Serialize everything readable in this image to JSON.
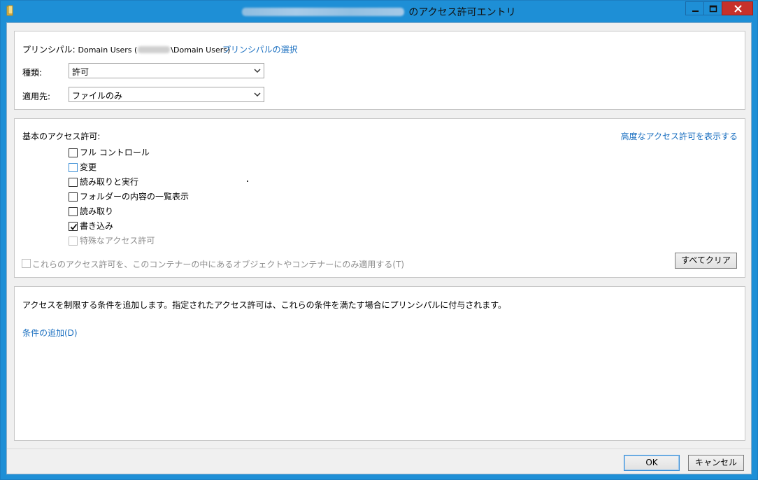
{
  "window": {
    "title_suffix": "のアクセス許可エントリ",
    "minimize_label": "",
    "maximize_label": "",
    "close_label": ""
  },
  "principal": {
    "label": "プリンシパル:",
    "value_prefix": "Domain Users (",
    "value_suffix": "\\Domain Users)",
    "select_link": "プリンシパルの選択"
  },
  "type_field": {
    "label": "種類:",
    "value": "許可"
  },
  "applies_field": {
    "label": "適用先:",
    "value": "ファイルのみ"
  },
  "basic_permissions": {
    "heading": "基本のアクセス許可:",
    "advanced_link": "高度なアクセス許可を表示する",
    "items": [
      {
        "label": "フル コントロール",
        "checked": false,
        "enabled": true
      },
      {
        "label": "変更",
        "checked": false,
        "enabled": true
      },
      {
        "label": "読み取りと実行",
        "checked": false,
        "enabled": true
      },
      {
        "label": "フォルダーの内容の一覧表示",
        "checked": false,
        "enabled": true
      },
      {
        "label": "読み取り",
        "checked": false,
        "enabled": true
      },
      {
        "label": "書き込み",
        "checked": true,
        "enabled": true
      },
      {
        "label": "特殊なアクセス許可",
        "checked": false,
        "enabled": false
      }
    ],
    "apply_only_label": "これらのアクセス許可を、このコンテナーの中にあるオブジェクトやコンテナーにのみ適用する(T)",
    "clear_all_button": "すべてクリア"
  },
  "conditions": {
    "description": "アクセスを制限する条件を追加します。指定されたアクセス許可は、これらの条件を満たす場合にプリンシパルに付与されます。",
    "add_link": "条件の追加(D)"
  },
  "footer": {
    "ok_button": "OK",
    "cancel_button": "キャンセル"
  },
  "colors": {
    "titlebar": "#1e8fd6",
    "close": "#c7312b",
    "link": "#1a6fc0",
    "client": "#f0f0f0"
  }
}
